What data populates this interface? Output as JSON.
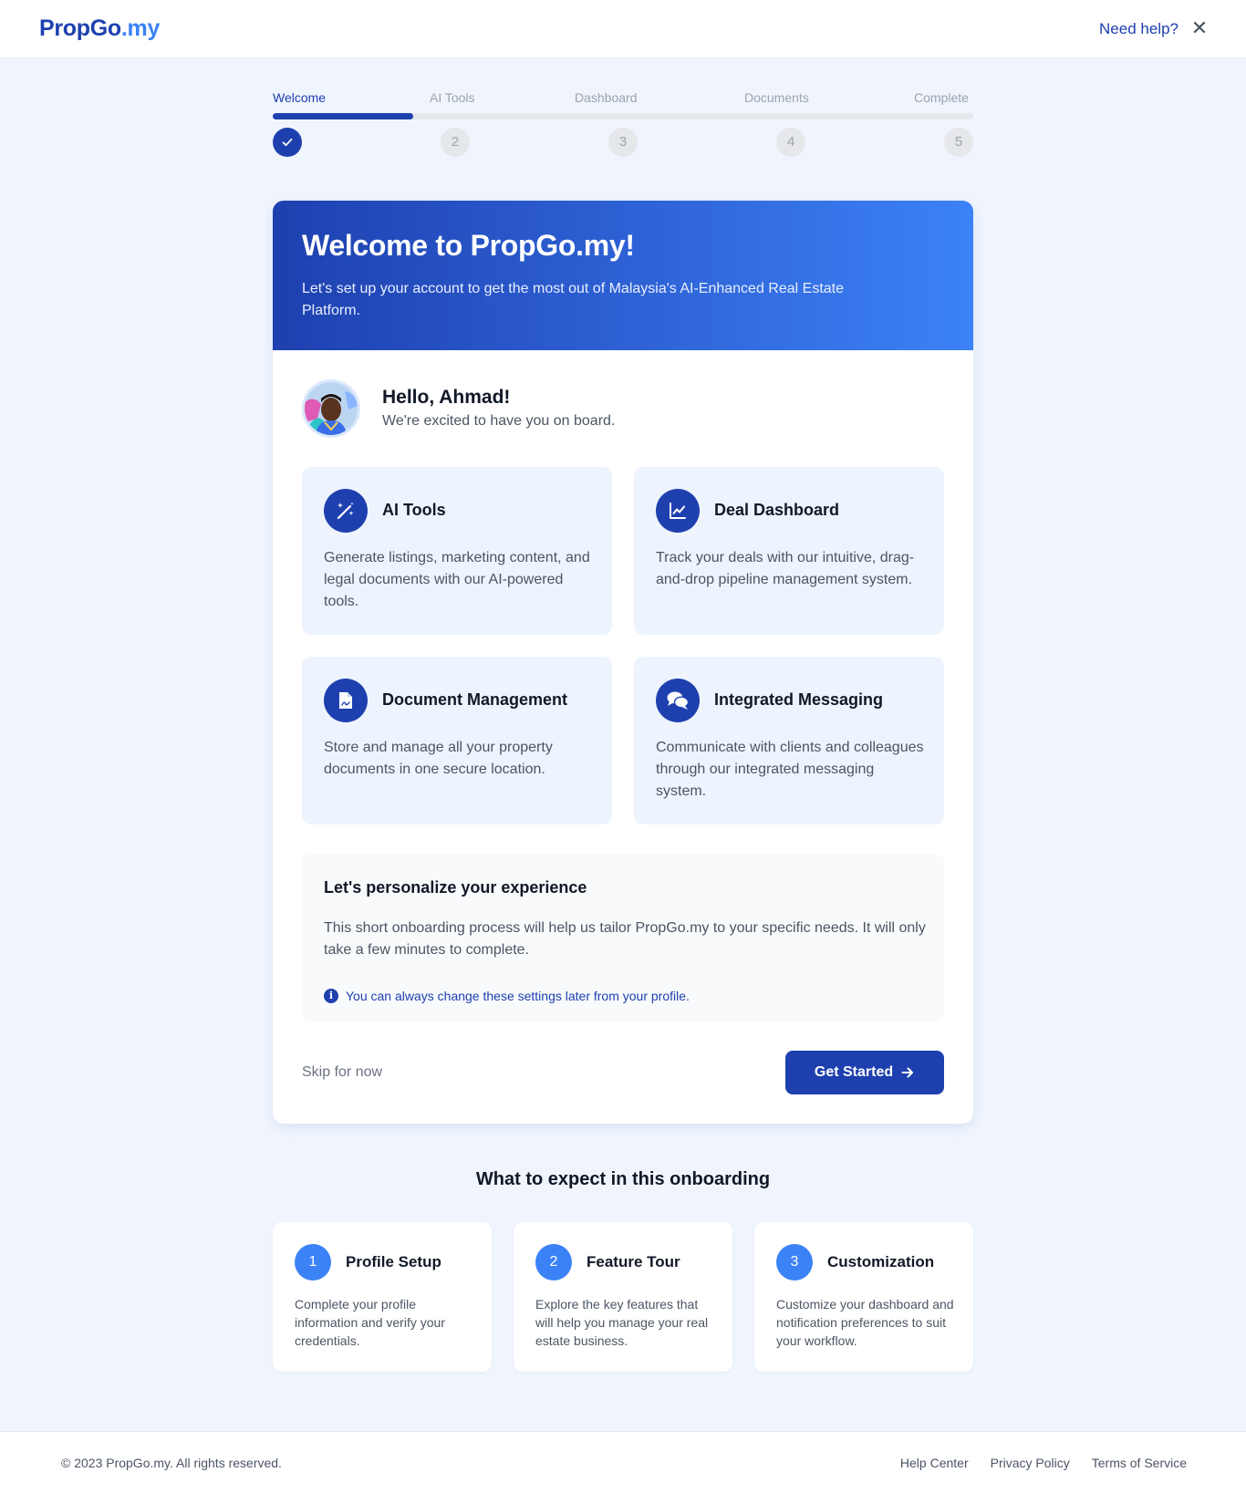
{
  "header": {
    "logo_main": "PropGo",
    "logo_tld": ".my",
    "help_label": "Need help?",
    "close_icon": "close-icon"
  },
  "stepper": {
    "progress": 0.2,
    "steps": [
      {
        "label": "Welcome",
        "number": "1",
        "state": "completed"
      },
      {
        "label": "AI Tools",
        "number": "2",
        "state": "pending"
      },
      {
        "label": "Dashboard",
        "number": "3",
        "state": "pending"
      },
      {
        "label": "Documents",
        "number": "4",
        "state": "pending"
      },
      {
        "label": "Complete",
        "number": "5",
        "state": "pending"
      }
    ]
  },
  "hero": {
    "title": "Welcome to PropGo.my!",
    "subtitle": "Let's set up your account to get the most out of Malaysia's AI-Enhanced Real Estate Platform."
  },
  "greeting": {
    "name": "Hello, Ahmad!",
    "subtitle": "We're excited to have you on board."
  },
  "features": [
    {
      "title": "AI Tools",
      "desc": "Generate listings, marketing content, and legal documents with our AI-powered tools.",
      "icon": "magic-wand-icon"
    },
    {
      "title": "Deal Dashboard",
      "desc": "Track your deals with our intuitive, drag-and-drop pipeline management system.",
      "icon": "chart-line-icon"
    },
    {
      "title": "Document Management",
      "desc": "Store and manage all your property documents in one secure location.",
      "icon": "document-icon"
    },
    {
      "title": "Integrated Messaging",
      "desc": "Communicate with clients and colleagues through our integrated messaging system.",
      "icon": "chat-bubbles-icon"
    }
  ],
  "personalize": {
    "title": "Let's personalize your experience",
    "body": "This short onboarding process will help us tailor PropGo.my to your specific needs. It will only take a few minutes to complete.",
    "note": "You can always change these settings later from your profile."
  },
  "actions": {
    "skip": "Skip for now",
    "primary": "Get Started"
  },
  "expect": {
    "title": "What to expect in this onboarding",
    "cards": [
      {
        "number": "1",
        "title": "Profile Setup",
        "desc": "Complete your profile information and verify your credentials."
      },
      {
        "number": "2",
        "title": "Feature Tour",
        "desc": "Explore the key features that will help you manage your real estate business."
      },
      {
        "number": "3",
        "title": "Customization",
        "desc": "Customize your dashboard and notification preferences to suit your workflow."
      }
    ]
  },
  "footer": {
    "copyright": "© 2023 PropGo.my. All rights reserved.",
    "links": [
      "Help Center",
      "Privacy Policy",
      "Terms of Service"
    ]
  },
  "colors": {
    "brand": "#1e40af",
    "accent": "#3b82f6",
    "background": "#f0f5fd"
  }
}
